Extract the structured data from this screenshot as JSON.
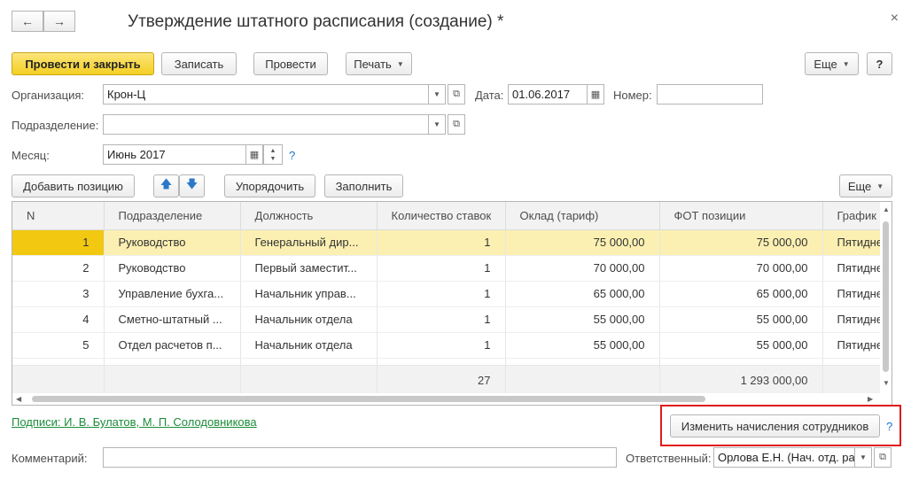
{
  "window": {
    "title": "Утверждение штатного расписания (создание) *",
    "back_icon": "←",
    "forward_icon": "→",
    "close_icon": "×"
  },
  "toolbar": {
    "post_close_label": "Провести и закрыть",
    "save_label": "Записать",
    "post_label": "Провести",
    "print_label": "Печать",
    "more_label": "Еще",
    "help_label": "?"
  },
  "form": {
    "organization_label": "Организация:",
    "organization_value": "Крон-Ц",
    "date_label": "Дата:",
    "date_value": "01.06.2017",
    "number_label": "Номер:",
    "number_value": "",
    "department_label": "Подразделение:",
    "department_value": "",
    "month_label": "Месяц:",
    "month_value": "Июнь 2017",
    "month_help": "?"
  },
  "table_toolbar": {
    "add_position_label": "Добавить позицию",
    "order_label": "Упорядочить",
    "fill_label": "Заполнить",
    "more_label": "Еще"
  },
  "table": {
    "columns": [
      "N",
      "Подразделение",
      "Должность",
      "Количество ставок",
      "Оклад (тариф)",
      "ФОТ  позиции",
      "График работы"
    ],
    "rows": [
      {
        "n": "1",
        "department": "Руководство",
        "position": "Генеральный дир...",
        "rates": "1",
        "salary": "75 000,00",
        "fot": "75 000,00",
        "schedule": "Пятидневка"
      },
      {
        "n": "2",
        "department": "Руководство",
        "position": "Первый заместит...",
        "rates": "1",
        "salary": "70 000,00",
        "fot": "70 000,00",
        "schedule": "Пятидневка"
      },
      {
        "n": "3",
        "department": "Управление бухга...",
        "position": "Начальник управ...",
        "rates": "1",
        "salary": "65 000,00",
        "fot": "65 000,00",
        "schedule": "Пятидневка"
      },
      {
        "n": "4",
        "department": "Сметно-штатный ...",
        "position": "Начальник отдела",
        "rates": "1",
        "salary": "55 000,00",
        "fot": "55 000,00",
        "schedule": "Пятидневка"
      },
      {
        "n": "5",
        "department": "Отдел расчетов п...",
        "position": "Начальник отдела",
        "rates": "1",
        "salary": "55 000,00",
        "fot": "55 000,00",
        "schedule": "Пятидневка"
      }
    ],
    "totals": {
      "rates": "27",
      "fot": "1 293 000,00"
    }
  },
  "footer": {
    "signatures_link": "Подписи: И. В. Булатов, М. П. Солодовникова",
    "change_accruals_label": "Изменить начисления сотрудников",
    "change_help": "?",
    "comment_label": "Комментарий:",
    "comment_value": "",
    "responsible_label": "Ответственный:",
    "responsible_value": "Орлова Е.Н. (Нач. отд. расчетов)"
  },
  "colors": {
    "primary_button": "#f4cf24",
    "selected_row": "#fbf0b2",
    "highlight_box": "#e01a1a",
    "link_green": "#1b8c3a"
  }
}
